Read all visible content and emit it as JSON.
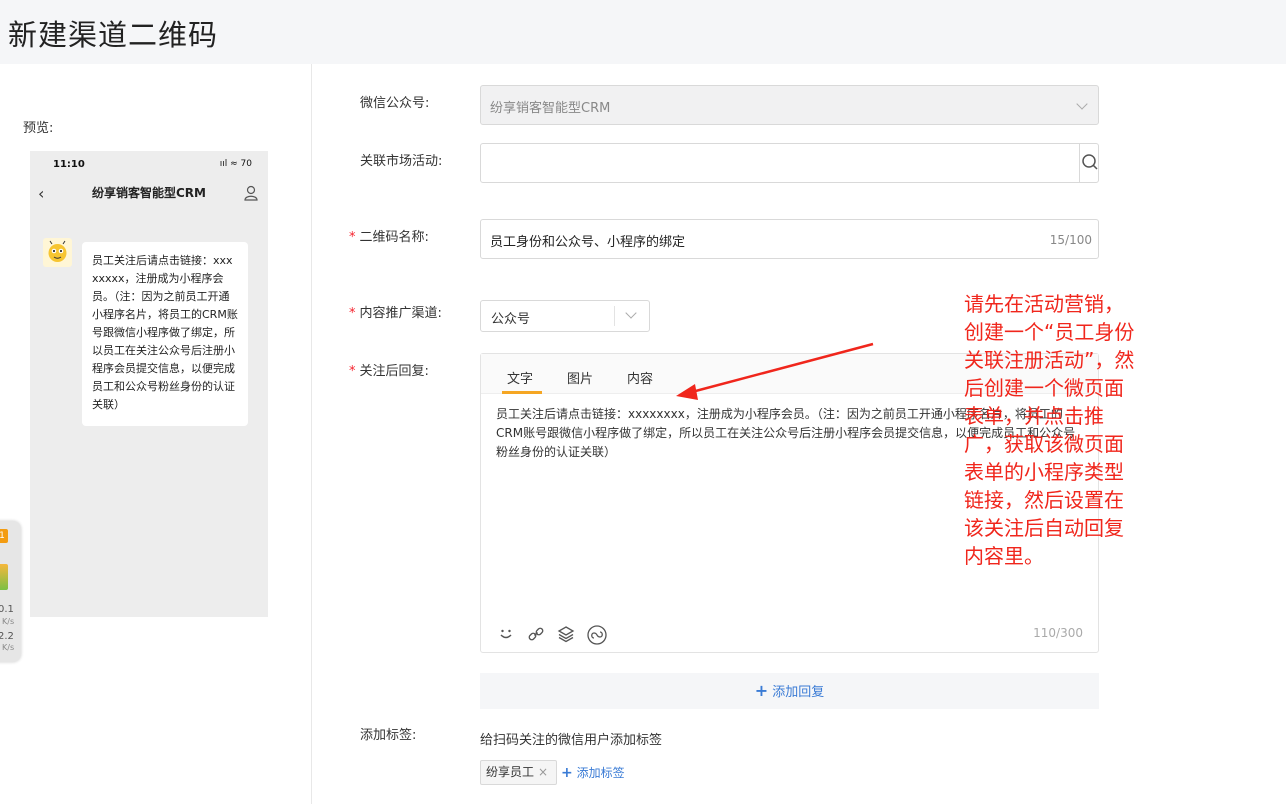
{
  "page": {
    "title": "新建渠道二维码"
  },
  "preview": {
    "label": "预览:",
    "phone": {
      "time": "11:10",
      "status_icons": "ııl ≈ 70",
      "title": "纷享销客智能型CRM",
      "message": "员工关注后请点击链接：xxxxxxxx，注册成为小程序会员。（注：因为之前员工开通小程序名片，将员工的CRM账号跟微信小程序做了绑定，所以员工在关注公众号后注册小程序会员提交信息，以便完成员工和公众号粉丝身份的认证关联）"
    }
  },
  "float_widget": {
    "badge": "1",
    "stat1": "0.1",
    "unit1": "K/s",
    "stat2": "2.2",
    "unit2": "K/s"
  },
  "form": {
    "wechat": {
      "label": "微信公众号:",
      "value": "纷享销客智能型CRM"
    },
    "campaign": {
      "label": "关联市场活动:",
      "value": ""
    },
    "qr_name": {
      "label": "二维码名称:",
      "required": "*",
      "value": "员工身份和公众号、小程序的绑定",
      "counter": "15/100"
    },
    "channel": {
      "label": "内容推广渠道:",
      "required": "*",
      "value": "公众号"
    },
    "reply": {
      "label": "关注后回复:",
      "required": "*",
      "tabs": [
        "文字",
        "图片",
        "内容"
      ],
      "active_tab": "文字",
      "text": "员工关注后请点击链接：xxxxxxxx，注册成为小程序会员。（注：因为之前员工开通小程序名片，将员工的CRM账号跟微信小程序做了绑定，所以员工在关注公众号后注册小程序会员提交信息，以便完成员工和公众号粉丝身份的认证关联）",
      "counter": "110/300",
      "add_reply": "添加回复"
    },
    "tags": {
      "label": "添加标签:",
      "hint": "给扫码关注的微信用户添加标签",
      "items": [
        "纷享员工"
      ],
      "add_label": "添加标签"
    }
  },
  "annotation": {
    "text": "请先在活动营销，创建一个“员工身份关联注册活动”，然后创建一个微页面表单，并点击推广，获取该微页面表单的小程序类型链接，然后设置在该关注后自动回复内容里。",
    "color": "#f0261c"
  },
  "colors": {
    "accent": "#3a7bd5",
    "tab_active": "#f5a623",
    "required": "#f5222d"
  }
}
